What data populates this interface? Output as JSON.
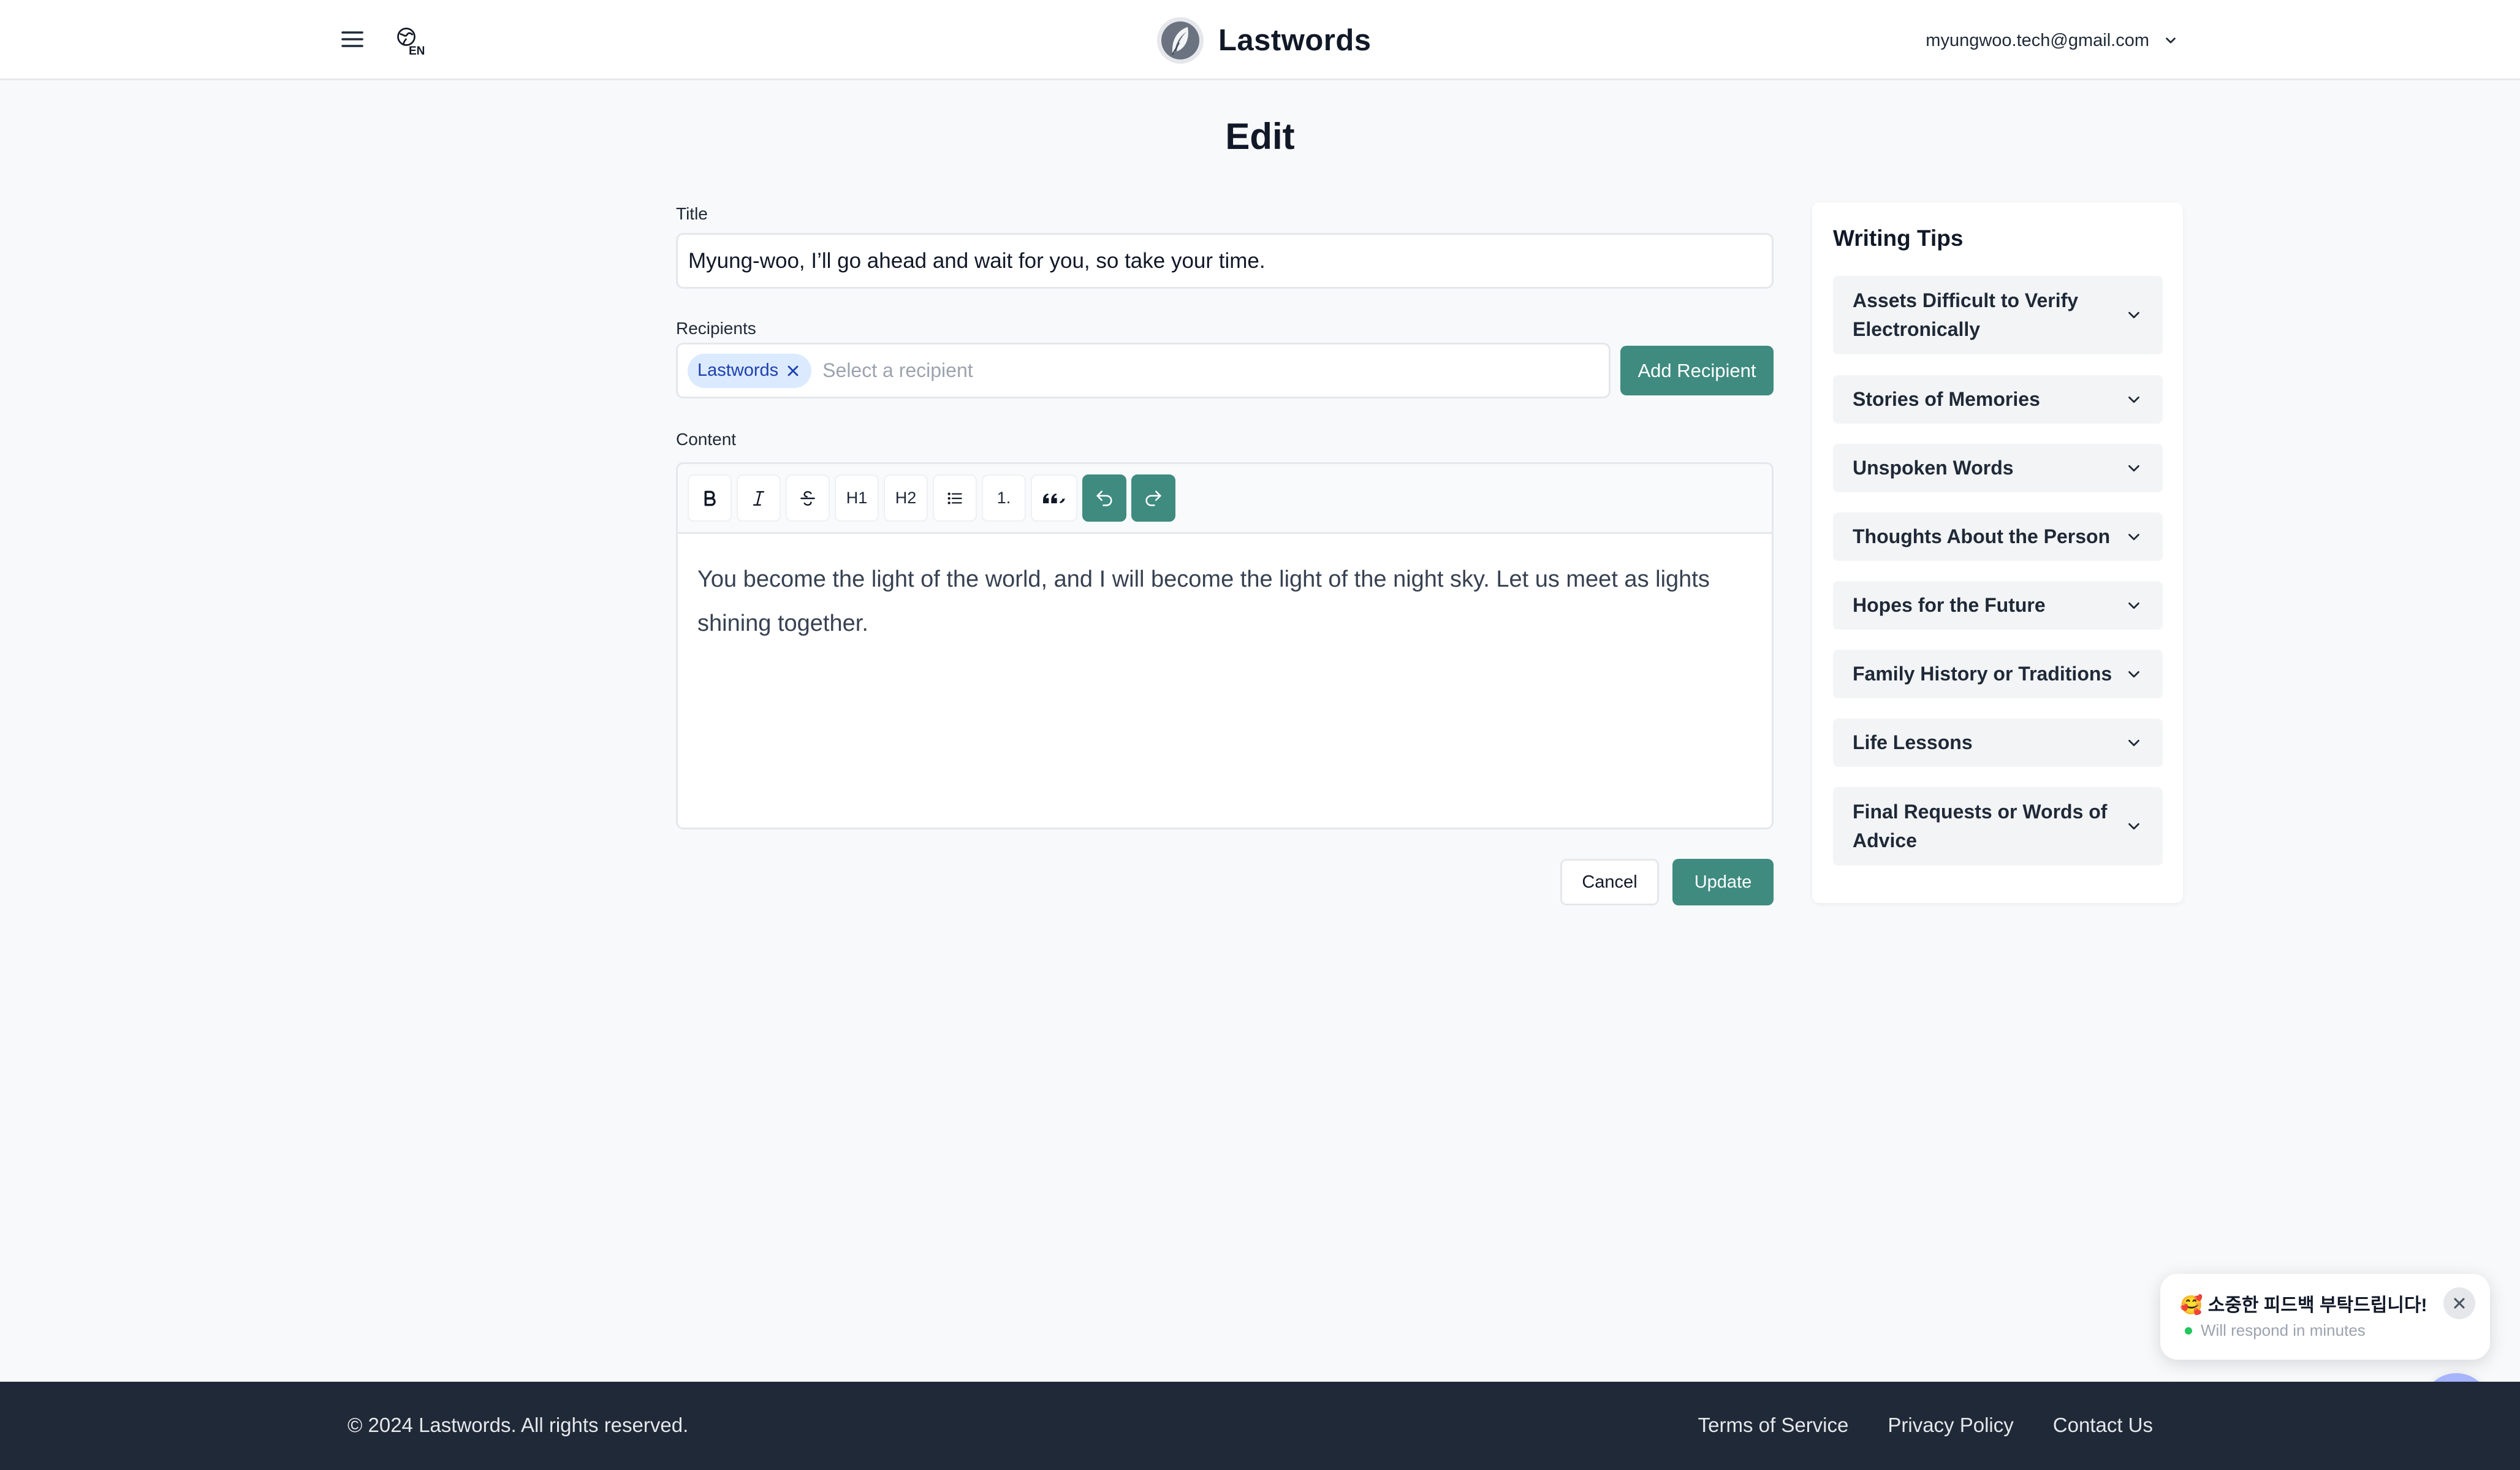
{
  "header": {
    "language_code": "EN",
    "brand_name": "Lastwords",
    "account_email": "myungwoo.tech@gmail.com"
  },
  "page": {
    "title": "Edit"
  },
  "form": {
    "title_label": "Title",
    "title_value": "Myung-woo, I’ll go ahead and wait for you, so take your time.",
    "recipients_label": "Recipients",
    "recipient_chips": [
      "Lastwords"
    ],
    "recipient_placeholder": "Select a recipient",
    "add_recipient_label": "Add Recipient",
    "content_label": "Content",
    "toolbar": {
      "h1": "H1",
      "h2": "H2",
      "ordered_list": "1."
    },
    "content_text": "You become the light of the world, and I will become the light of the night sky. Let us meet as lights shining together.",
    "cancel_label": "Cancel",
    "update_label": "Update"
  },
  "tips": {
    "title": "Writing Tips",
    "items": [
      "Assets Difficult to Verify Electronically",
      "Stories of Memories",
      "Unspoken Words",
      "Thoughts About the Person",
      "Hopes for the Future",
      "Family History or Traditions",
      "Life Lessons",
      "Final Requests or Words of Advice"
    ]
  },
  "feedback": {
    "message": "🥰 소중한 피드백 부탁드립니다!",
    "status": "Will respond in minutes"
  },
  "footer": {
    "copyright": "© 2024 Lastwords. All rights reserved.",
    "links": [
      "Terms of Service",
      "Privacy Policy",
      "Contact Us"
    ]
  },
  "colors": {
    "accent": "#3f8b80",
    "footer_bg": "#1f2937",
    "page_bg": "#f8f9fb",
    "chip_bg": "#dbeafe",
    "chip_text": "#1e40af",
    "fab_bg": "#a5b4fc"
  },
  "icons": {
    "menu": "hamburger-icon",
    "language": "globe-icon",
    "brand": "feather-logo",
    "account_dropdown": "chevron-down-icon",
    "chip_remove": "close-icon",
    "tip_toggle": "chevron-down-icon",
    "feedback_close": "close-icon",
    "fab": "send-icon"
  }
}
